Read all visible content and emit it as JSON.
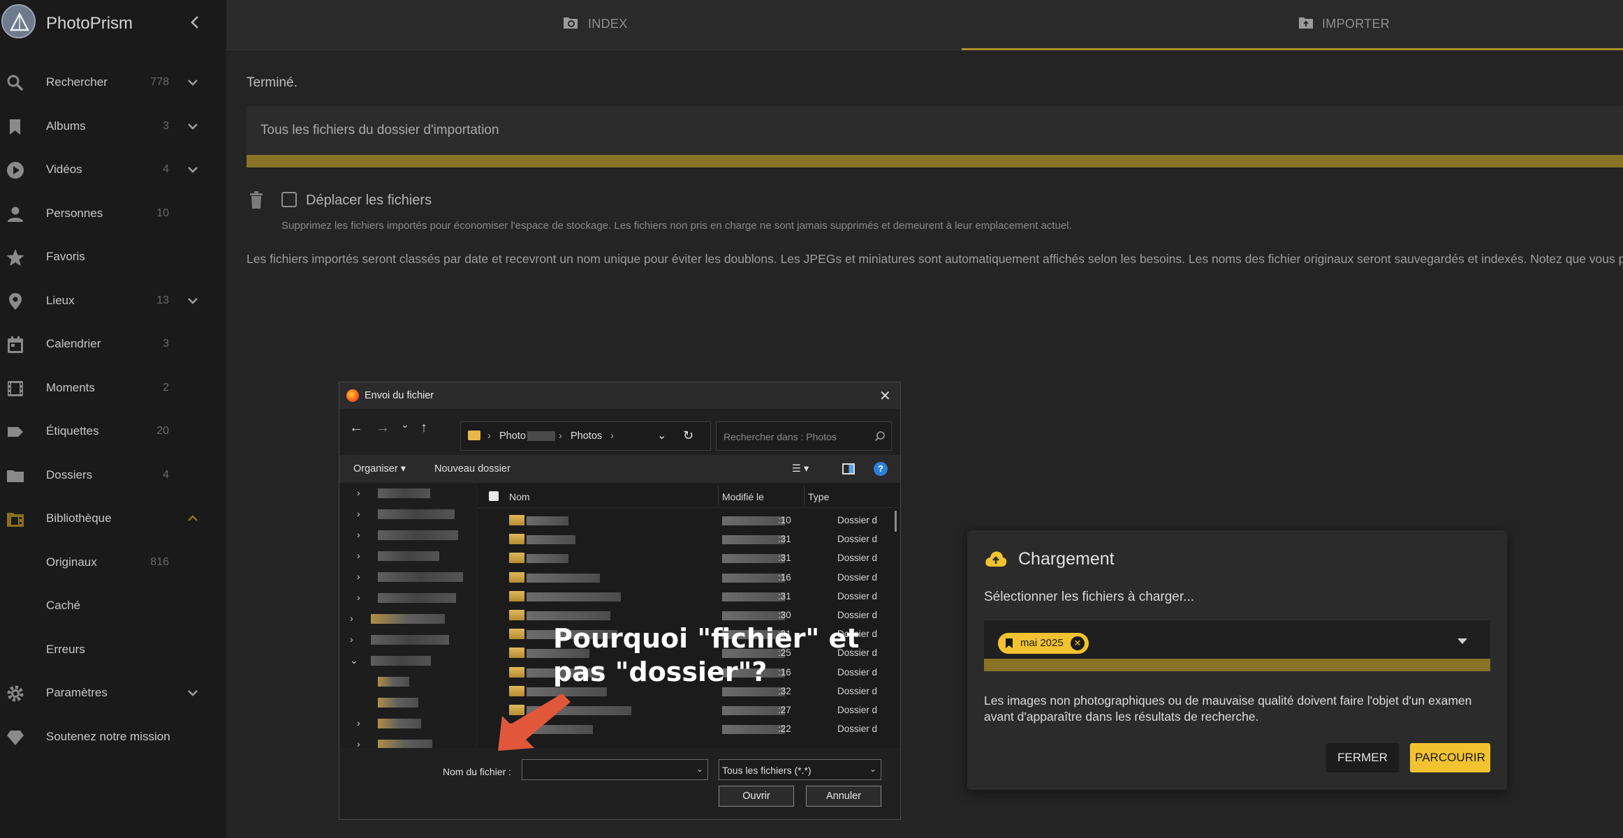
{
  "app": {
    "title": "PhotoPrism"
  },
  "sidebar": {
    "items": [
      {
        "label": "Rechercher",
        "count": "778"
      },
      {
        "label": "Albums",
        "count": "3"
      },
      {
        "label": "Vidéos",
        "count": "4"
      },
      {
        "label": "Personnes",
        "count": "10"
      },
      {
        "label": "Favoris",
        "count": ""
      },
      {
        "label": "Lieux",
        "count": "13"
      },
      {
        "label": "Calendrier",
        "count": "3"
      },
      {
        "label": "Moments",
        "count": "2"
      },
      {
        "label": "Étiquettes",
        "count": "20"
      },
      {
        "label": "Dossiers",
        "count": "4"
      },
      {
        "label": "Bibliothèque",
        "count": ""
      },
      {
        "label": "Originaux",
        "count": "816"
      },
      {
        "label": "Caché",
        "count": ""
      },
      {
        "label": "Erreurs",
        "count": ""
      },
      {
        "label": "Paramètres",
        "count": ""
      },
      {
        "label": "Soutenez notre mission",
        "count": ""
      }
    ]
  },
  "tabs": {
    "index": "INDEX",
    "import": "IMPORTER"
  },
  "main": {
    "status": "Terminé.",
    "import_folder": "Tous les fichiers du dossier d'importation",
    "move_files_label": "Déplacer les fichiers",
    "move_files_hint": "Supprimez les fichiers importés pour économiser l'espace de stockage. Les fichiers non pris en charge ne sont jamais supprimés et demeurent à leur emplacement actuel.",
    "info": "Les fichiers importés seront classés par date et recevront un nom unique pour éviter les doublons. Les JPEGs et miniatures sont automatiquement affichés selon les besoins. Les noms des fichier originaux seront sauvegardés et indexés. Notez que vous pouv"
  },
  "upload_dialog": {
    "title": "Chargement",
    "subtitle": "Sélectionner les fichiers à charger...",
    "chip": "mai 2025",
    "note": "Les images non photographiques ou de mauvaise qualité doivent faire l'objet d'un examen avant d'apparaître dans les résultats de recherche.",
    "close_button": "FERMER",
    "browse_button": "PARCOURIR",
    "accent_color": "#f2c230"
  },
  "file_dialog": {
    "title": "Envoi du fichier",
    "path": [
      "Photo",
      "Photos"
    ],
    "search_placeholder": "Rechercher dans : Photos",
    "organize": "Organiser",
    "new_folder": "Nouveau dossier",
    "columns": {
      "name": "Nom",
      "modified": "Modifié le",
      "type": "Type"
    },
    "rows": [
      {
        "time": ":10",
        "type": "Dossier d"
      },
      {
        "time": ":31",
        "type": "Dossier d"
      },
      {
        "time": ":31",
        "type": "Dossier d"
      },
      {
        "time": ":16",
        "type": "Dossier d"
      },
      {
        "time": ":31",
        "type": "Dossier d"
      },
      {
        "time": ":30",
        "type": "Dossier d"
      },
      {
        "time": ":31",
        "type": "Dossier d"
      },
      {
        "time": ":25",
        "type": "Dossier d"
      },
      {
        "time": ":16",
        "type": "Dossier d"
      },
      {
        "time": ":32",
        "type": "Dossier d"
      },
      {
        "time": ":27",
        "type": "Dossier d"
      },
      {
        "time": ":22",
        "type": "Dossier d"
      }
    ],
    "filename_label": "Nom du fichier :",
    "filetype": "Tous les fichiers (*.*)",
    "open_button": "Ouvrir",
    "cancel_button": "Annuler"
  },
  "annotation": {
    "line1": "Pourquoi \"fichier\" et",
    "line2": "pas \"dossier\"?",
    "color": "#e0573a"
  }
}
